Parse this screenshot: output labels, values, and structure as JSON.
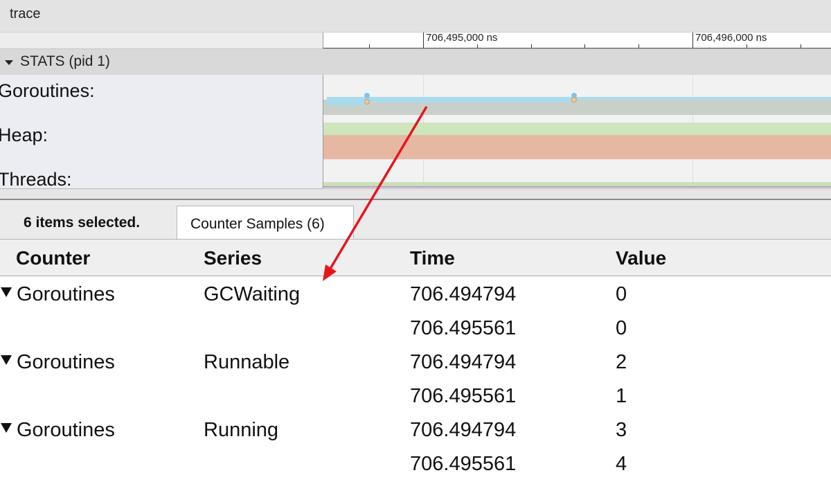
{
  "window": {
    "title": "trace"
  },
  "ruler": {
    "labels": [
      "706,495,000 ns",
      "706,496,000 ns"
    ]
  },
  "stats": {
    "header_label": "STATS (pid 1)",
    "counters": [
      "Goroutines:",
      "Heap:",
      "Threads:"
    ]
  },
  "colors": {
    "goroutines_light": "#a9dbef",
    "goroutines_gray": "#c9d0c9",
    "heap_green": "#cfe5bd",
    "heap_orange": "#e7b8a1",
    "threads_green": "#c9e1b8",
    "arrow": "#e8141c"
  },
  "analysis": {
    "selection_label": "6 items selected.",
    "tab_label": "Counter Samples (6)",
    "columns": [
      "Counter",
      "Series",
      "Time",
      "Value"
    ],
    "rows": [
      {
        "counter": "Goroutines",
        "series": "GCWaiting",
        "time": "706.494794",
        "value": "0"
      },
      {
        "counter": "",
        "series": "",
        "time": "706.495561",
        "value": "0"
      },
      {
        "counter": "Goroutines",
        "series": "Runnable",
        "time": "706.494794",
        "value": "2"
      },
      {
        "counter": "",
        "series": "",
        "time": "706.495561",
        "value": "1"
      },
      {
        "counter": "Goroutines",
        "series": "Running",
        "time": "706.494794",
        "value": "3"
      },
      {
        "counter": "",
        "series": "",
        "time": "706.495561",
        "value": "4"
      }
    ]
  }
}
